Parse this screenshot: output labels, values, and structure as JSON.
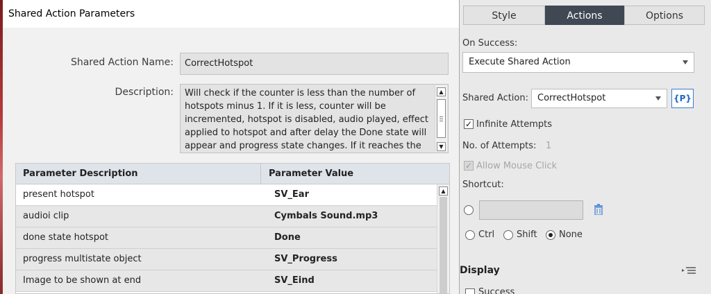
{
  "dialog": {
    "title": "Shared Action Parameters",
    "name_label": "Shared Action Name:",
    "name_value": "CorrectHotspot",
    "description_label": "Description:",
    "description_text": "Will check if the counter is less than the number of hotspots minus 1. If it is less, counter will be incremented, hotspot is disabled, audio played, effect applied to hotspot and after delay the Done state will appear and progress state changes.   If it reaches the number the final image",
    "table": {
      "headers": [
        "Parameter Description",
        "Parameter Value"
      ],
      "rows": [
        {
          "description": "present hotspot",
          "value": "SV_Ear"
        },
        {
          "description": "audioi clip",
          "value": "Cymbals Sound.mp3"
        },
        {
          "description": "done state hotspot",
          "value": "Done"
        },
        {
          "description": "progress multistate object",
          "value": "SV_Progress"
        },
        {
          "description": "Image to be shown at end",
          "value": "SV_Eind"
        }
      ]
    }
  },
  "panel": {
    "tabs": [
      "Style",
      "Actions",
      "Options"
    ],
    "active_tab": "Actions",
    "on_success_label": "On Success:",
    "on_success_value": "Execute Shared Action",
    "shared_action_label": "Shared Action:",
    "shared_action_value": "CorrectHotspot",
    "params_button": "{P}",
    "infinite_attempts_label": "Infinite Attempts",
    "infinite_attempts_checked": true,
    "attempts_label": "No. of Attempts:",
    "attempts_value": "1",
    "allow_mouse_click_label": "Allow Mouse Click",
    "shortcut_label": "Shortcut:",
    "modifiers": [
      "Ctrl",
      "Shift",
      "None"
    ],
    "selected_modifier": "None",
    "display_label": "Display",
    "success_label": "Success"
  },
  "colors": {
    "active_tab": "#404854",
    "accent": "#1f66c8"
  }
}
